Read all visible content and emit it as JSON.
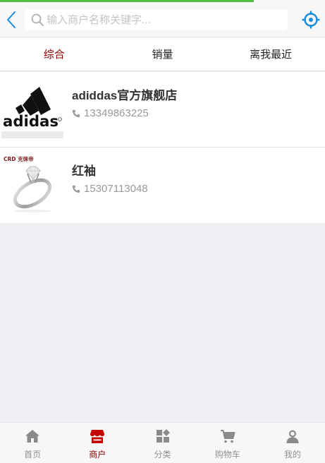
{
  "progress": {
    "loaded_fraction": 0.78
  },
  "header": {
    "back_icon": "chevron-left-icon",
    "search_placeholder": "输入商户名称关键字...",
    "search_value": "",
    "search_icon": "search-icon",
    "locate_icon": "crosshair-icon"
  },
  "tabs": [
    {
      "label": "综合",
      "active": true
    },
    {
      "label": "销量",
      "active": false
    },
    {
      "label": "离我最近",
      "active": false
    }
  ],
  "shops": [
    {
      "name": "adiddas官方旗舰店",
      "phone": "13349863225",
      "logo": "adidas-logo"
    },
    {
      "name": "红袖",
      "phone": "15307113048",
      "logo": "crd-ring-image",
      "logo_text": "CRD 克徕帝"
    }
  ],
  "tabbar": [
    {
      "label": "首页",
      "icon": "home-icon",
      "active": false
    },
    {
      "label": "商户",
      "icon": "store-icon",
      "active": true
    },
    {
      "label": "分类",
      "icon": "category-icon",
      "active": false
    },
    {
      "label": "购物车",
      "icon": "cart-icon",
      "active": false
    },
    {
      "label": "我的",
      "icon": "user-icon",
      "active": false
    }
  ],
  "colors": {
    "accent": "#8b0000",
    "progress": "#4cc03c",
    "link_blue": "#1a8cdb",
    "muted": "#929292"
  }
}
